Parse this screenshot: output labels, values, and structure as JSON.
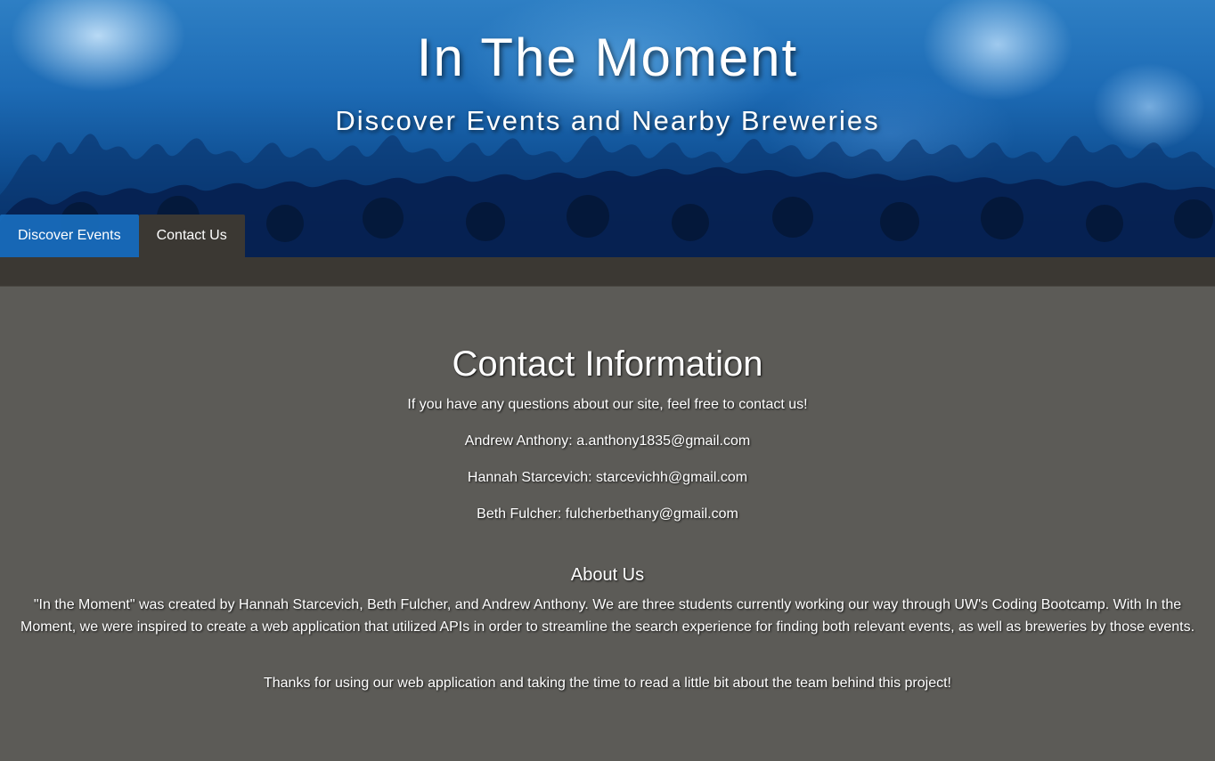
{
  "hero": {
    "title": "In The Moment",
    "subtitle": "Discover Events and Nearby Breweries"
  },
  "nav": {
    "tabs": [
      {
        "label": "Discover Events",
        "active": false
      },
      {
        "label": "Contact Us",
        "active": true
      }
    ]
  },
  "contact": {
    "heading": "Contact Information",
    "intro": "If you have any questions about our site, feel free to contact us!",
    "people": [
      {
        "line": "Andrew Anthony: a.anthony1835@gmail.com"
      },
      {
        "line": "Hannah Starcevich: starcevichh@gmail.com"
      },
      {
        "line": "Beth Fulcher: fulcherbethany@gmail.com"
      }
    ]
  },
  "about": {
    "heading": "About Us",
    "text": "\"In the Moment\" was created by Hannah Starcevich, Beth Fulcher, and Andrew Anthony. We are three students currently working our way through UW's Coding Bootcamp. With In the Moment, we were inspired to create a web application that utilized APIs in order to streamline the search experience for finding both relevant events, as well as breweries by those events.",
    "thanks": "Thanks for using our web application and taking the time to read a little bit about the team behind this project!"
  },
  "colors": {
    "page_background": "#5c5b57",
    "tab_strip": "#3b3833",
    "tab_primary": "#1c6ebe",
    "hero_blue": "#1d6bb5"
  }
}
